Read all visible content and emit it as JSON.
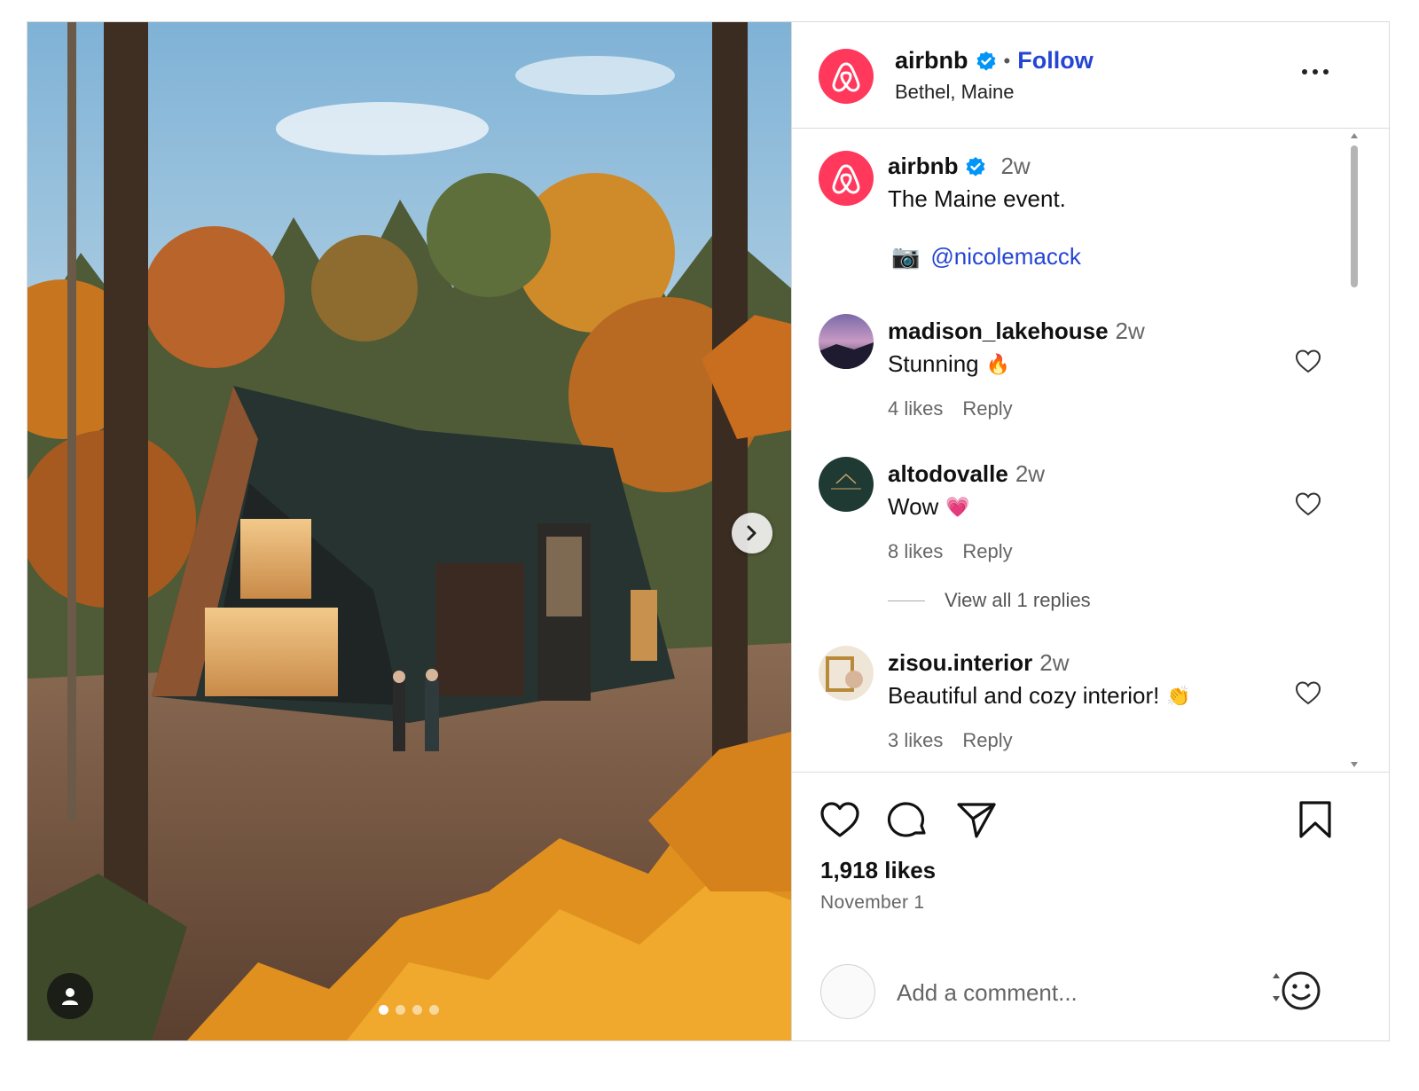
{
  "post": {
    "username": "airbnb",
    "follow_label": "Follow",
    "location": "Bethel, Maine",
    "carousel_count": 4,
    "carousel_active": 1
  },
  "caption": {
    "username": "airbnb",
    "time": "2w",
    "text": "The Maine event.",
    "credit_emoji": "📷",
    "credit_handle": "@nicolemacck"
  },
  "comments": [
    {
      "username": "madison_lakehouse",
      "time": "2w",
      "text": "Stunning",
      "emoji": "🔥",
      "likes": "4 likes",
      "reply": "Reply"
    },
    {
      "username": "altodovalle",
      "time": "2w",
      "text": "Wow",
      "emoji": "💗",
      "likes": "8 likes",
      "reply": "Reply",
      "view_replies": "View all 1 replies"
    },
    {
      "username": "zisou.interior",
      "time": "2w",
      "text": "Beautiful and cozy interior!",
      "emoji": "👏",
      "likes": "3 likes",
      "reply": "Reply"
    }
  ],
  "stats": {
    "likes": "1,918 likes",
    "date": "November 1"
  },
  "composer": {
    "placeholder": "Add a comment..."
  },
  "colors": {
    "brand": "#ff385c",
    "link": "#2545d3",
    "verified": "#0095f6"
  }
}
